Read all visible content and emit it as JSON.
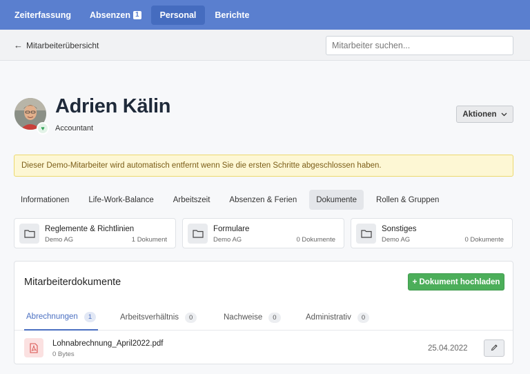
{
  "nav": {
    "items": [
      {
        "label": "Zeiterfassung",
        "badge": null,
        "active": false
      },
      {
        "label": "Absenzen",
        "badge": "1",
        "active": false
      },
      {
        "label": "Personal",
        "badge": null,
        "active": true
      },
      {
        "label": "Berichte",
        "badge": null,
        "active": false
      }
    ]
  },
  "subbar": {
    "back_label": "Mitarbeiterübersicht",
    "search_placeholder": "Mitarbeiter suchen..."
  },
  "employee": {
    "name": "Adrien Kälin",
    "role": "Accountant",
    "actions_label": "Aktionen"
  },
  "alert": {
    "text": "Dieser Demo-Mitarbeiter wird automatisch entfernt wenn Sie die ersten Schritte abgeschlossen haben."
  },
  "tabs": [
    {
      "label": "Informationen",
      "active": false
    },
    {
      "label": "Life-Work-Balance",
      "active": false
    },
    {
      "label": "Arbeitszeit",
      "active": false
    },
    {
      "label": "Absenzen & Ferien",
      "active": false
    },
    {
      "label": "Dokumente",
      "active": true
    },
    {
      "label": "Rollen & Gruppen",
      "active": false
    }
  ],
  "folders": [
    {
      "title": "Reglemente & Richtlinien",
      "company": "Demo AG",
      "count": "1 Dokument"
    },
    {
      "title": "Formulare",
      "company": "Demo AG",
      "count": "0 Dokumente"
    },
    {
      "title": "Sonstiges",
      "company": "Demo AG",
      "count": "0 Dokumente"
    }
  ],
  "documents": {
    "title": "Mitarbeiterdokumente",
    "upload_label": "+ Dokument hochladen",
    "tabs": [
      {
        "label": "Abrechnungen",
        "count": "1",
        "active": true
      },
      {
        "label": "Arbeitsverhältnis",
        "count": "0",
        "active": false
      },
      {
        "label": "Nachweise",
        "count": "0",
        "active": false
      },
      {
        "label": "Administrativ",
        "count": "0",
        "active": false
      }
    ],
    "rows": [
      {
        "name": "Lohnabrechnung_April2022.pdf",
        "size": "0 Bytes",
        "date": "25.04.2022"
      }
    ]
  },
  "colors": {
    "nav_bg": "#5a7fcf",
    "accent": "#4a6fc1",
    "success": "#4cae5a",
    "alert_bg": "#fdf7d4"
  }
}
